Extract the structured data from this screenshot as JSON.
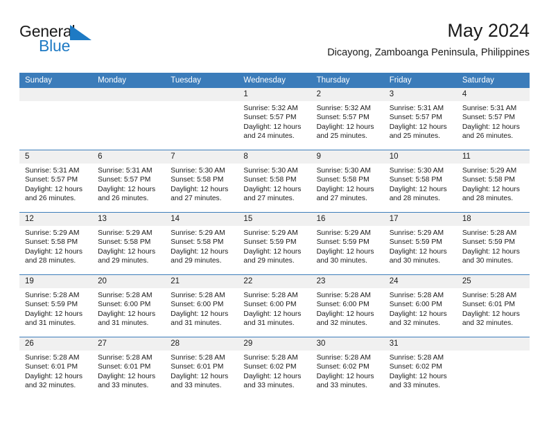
{
  "brand": {
    "name_top": "General",
    "name_bottom": "Blue",
    "accent_color": "#1e7ac4",
    "flag_icon": "triangle-flag-icon"
  },
  "header": {
    "title": "May 2024",
    "subtitle": "Dicayong, Zamboanga Peninsula, Philippines"
  },
  "theme": {
    "header_bg": "#3b7cba",
    "daynum_bg": "#f0f0f0",
    "row_rule": "#3b7cba",
    "text": "#1a1a1a"
  },
  "weekday_headers": [
    "Sunday",
    "Monday",
    "Tuesday",
    "Wednesday",
    "Thursday",
    "Friday",
    "Saturday"
  ],
  "weeks": [
    [
      {
        "day": "",
        "sunrise": "",
        "sunset": "",
        "daylight_line1": "",
        "daylight_line2": ""
      },
      {
        "day": "",
        "sunrise": "",
        "sunset": "",
        "daylight_line1": "",
        "daylight_line2": ""
      },
      {
        "day": "",
        "sunrise": "",
        "sunset": "",
        "daylight_line1": "",
        "daylight_line2": ""
      },
      {
        "day": "1",
        "sunrise": "Sunrise: 5:32 AM",
        "sunset": "Sunset: 5:57 PM",
        "daylight_line1": "Daylight: 12 hours",
        "daylight_line2": "and 24 minutes."
      },
      {
        "day": "2",
        "sunrise": "Sunrise: 5:32 AM",
        "sunset": "Sunset: 5:57 PM",
        "daylight_line1": "Daylight: 12 hours",
        "daylight_line2": "and 25 minutes."
      },
      {
        "day": "3",
        "sunrise": "Sunrise: 5:31 AM",
        "sunset": "Sunset: 5:57 PM",
        "daylight_line1": "Daylight: 12 hours",
        "daylight_line2": "and 25 minutes."
      },
      {
        "day": "4",
        "sunrise": "Sunrise: 5:31 AM",
        "sunset": "Sunset: 5:57 PM",
        "daylight_line1": "Daylight: 12 hours",
        "daylight_line2": "and 26 minutes."
      }
    ],
    [
      {
        "day": "5",
        "sunrise": "Sunrise: 5:31 AM",
        "sunset": "Sunset: 5:57 PM",
        "daylight_line1": "Daylight: 12 hours",
        "daylight_line2": "and 26 minutes."
      },
      {
        "day": "6",
        "sunrise": "Sunrise: 5:31 AM",
        "sunset": "Sunset: 5:57 PM",
        "daylight_line1": "Daylight: 12 hours",
        "daylight_line2": "and 26 minutes."
      },
      {
        "day": "7",
        "sunrise": "Sunrise: 5:30 AM",
        "sunset": "Sunset: 5:58 PM",
        "daylight_line1": "Daylight: 12 hours",
        "daylight_line2": "and 27 minutes."
      },
      {
        "day": "8",
        "sunrise": "Sunrise: 5:30 AM",
        "sunset": "Sunset: 5:58 PM",
        "daylight_line1": "Daylight: 12 hours",
        "daylight_line2": "and 27 minutes."
      },
      {
        "day": "9",
        "sunrise": "Sunrise: 5:30 AM",
        "sunset": "Sunset: 5:58 PM",
        "daylight_line1": "Daylight: 12 hours",
        "daylight_line2": "and 27 minutes."
      },
      {
        "day": "10",
        "sunrise": "Sunrise: 5:30 AM",
        "sunset": "Sunset: 5:58 PM",
        "daylight_line1": "Daylight: 12 hours",
        "daylight_line2": "and 28 minutes."
      },
      {
        "day": "11",
        "sunrise": "Sunrise: 5:29 AM",
        "sunset": "Sunset: 5:58 PM",
        "daylight_line1": "Daylight: 12 hours",
        "daylight_line2": "and 28 minutes."
      }
    ],
    [
      {
        "day": "12",
        "sunrise": "Sunrise: 5:29 AM",
        "sunset": "Sunset: 5:58 PM",
        "daylight_line1": "Daylight: 12 hours",
        "daylight_line2": "and 28 minutes."
      },
      {
        "day": "13",
        "sunrise": "Sunrise: 5:29 AM",
        "sunset": "Sunset: 5:58 PM",
        "daylight_line1": "Daylight: 12 hours",
        "daylight_line2": "and 29 minutes."
      },
      {
        "day": "14",
        "sunrise": "Sunrise: 5:29 AM",
        "sunset": "Sunset: 5:58 PM",
        "daylight_line1": "Daylight: 12 hours",
        "daylight_line2": "and 29 minutes."
      },
      {
        "day": "15",
        "sunrise": "Sunrise: 5:29 AM",
        "sunset": "Sunset: 5:59 PM",
        "daylight_line1": "Daylight: 12 hours",
        "daylight_line2": "and 29 minutes."
      },
      {
        "day": "16",
        "sunrise": "Sunrise: 5:29 AM",
        "sunset": "Sunset: 5:59 PM",
        "daylight_line1": "Daylight: 12 hours",
        "daylight_line2": "and 30 minutes."
      },
      {
        "day": "17",
        "sunrise": "Sunrise: 5:29 AM",
        "sunset": "Sunset: 5:59 PM",
        "daylight_line1": "Daylight: 12 hours",
        "daylight_line2": "and 30 minutes."
      },
      {
        "day": "18",
        "sunrise": "Sunrise: 5:28 AM",
        "sunset": "Sunset: 5:59 PM",
        "daylight_line1": "Daylight: 12 hours",
        "daylight_line2": "and 30 minutes."
      }
    ],
    [
      {
        "day": "19",
        "sunrise": "Sunrise: 5:28 AM",
        "sunset": "Sunset: 5:59 PM",
        "daylight_line1": "Daylight: 12 hours",
        "daylight_line2": "and 31 minutes."
      },
      {
        "day": "20",
        "sunrise": "Sunrise: 5:28 AM",
        "sunset": "Sunset: 6:00 PM",
        "daylight_line1": "Daylight: 12 hours",
        "daylight_line2": "and 31 minutes."
      },
      {
        "day": "21",
        "sunrise": "Sunrise: 5:28 AM",
        "sunset": "Sunset: 6:00 PM",
        "daylight_line1": "Daylight: 12 hours",
        "daylight_line2": "and 31 minutes."
      },
      {
        "day": "22",
        "sunrise": "Sunrise: 5:28 AM",
        "sunset": "Sunset: 6:00 PM",
        "daylight_line1": "Daylight: 12 hours",
        "daylight_line2": "and 31 minutes."
      },
      {
        "day": "23",
        "sunrise": "Sunrise: 5:28 AM",
        "sunset": "Sunset: 6:00 PM",
        "daylight_line1": "Daylight: 12 hours",
        "daylight_line2": "and 32 minutes."
      },
      {
        "day": "24",
        "sunrise": "Sunrise: 5:28 AM",
        "sunset": "Sunset: 6:00 PM",
        "daylight_line1": "Daylight: 12 hours",
        "daylight_line2": "and 32 minutes."
      },
      {
        "day": "25",
        "sunrise": "Sunrise: 5:28 AM",
        "sunset": "Sunset: 6:01 PM",
        "daylight_line1": "Daylight: 12 hours",
        "daylight_line2": "and 32 minutes."
      }
    ],
    [
      {
        "day": "26",
        "sunrise": "Sunrise: 5:28 AM",
        "sunset": "Sunset: 6:01 PM",
        "daylight_line1": "Daylight: 12 hours",
        "daylight_line2": "and 32 minutes."
      },
      {
        "day": "27",
        "sunrise": "Sunrise: 5:28 AM",
        "sunset": "Sunset: 6:01 PM",
        "daylight_line1": "Daylight: 12 hours",
        "daylight_line2": "and 33 minutes."
      },
      {
        "day": "28",
        "sunrise": "Sunrise: 5:28 AM",
        "sunset": "Sunset: 6:01 PM",
        "daylight_line1": "Daylight: 12 hours",
        "daylight_line2": "and 33 minutes."
      },
      {
        "day": "29",
        "sunrise": "Sunrise: 5:28 AM",
        "sunset": "Sunset: 6:02 PM",
        "daylight_line1": "Daylight: 12 hours",
        "daylight_line2": "and 33 minutes."
      },
      {
        "day": "30",
        "sunrise": "Sunrise: 5:28 AM",
        "sunset": "Sunset: 6:02 PM",
        "daylight_line1": "Daylight: 12 hours",
        "daylight_line2": "and 33 minutes."
      },
      {
        "day": "31",
        "sunrise": "Sunrise: 5:28 AM",
        "sunset": "Sunset: 6:02 PM",
        "daylight_line1": "Daylight: 12 hours",
        "daylight_line2": "and 33 minutes."
      },
      {
        "day": "",
        "sunrise": "",
        "sunset": "",
        "daylight_line1": "",
        "daylight_line2": ""
      }
    ]
  ]
}
